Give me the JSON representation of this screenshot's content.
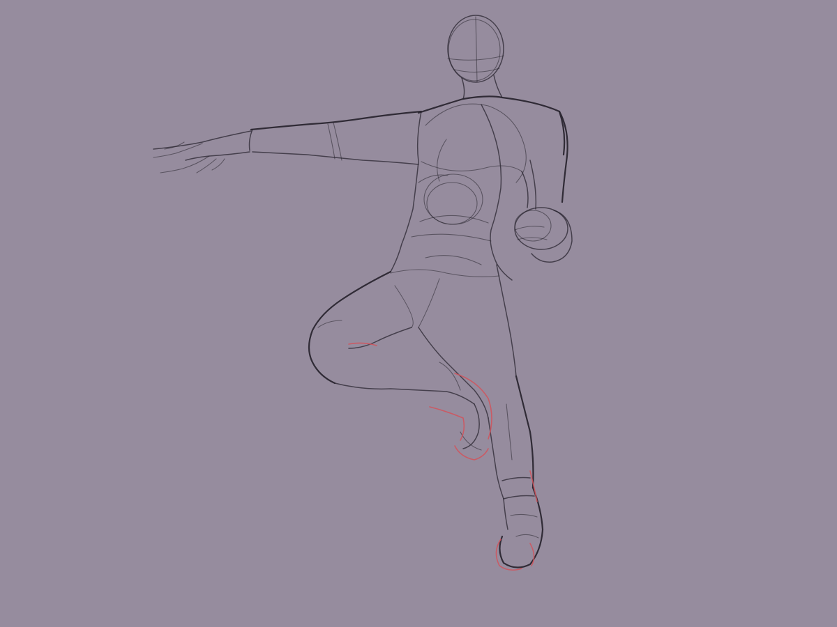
{
  "canvas": {
    "background": "#968c9e",
    "ink_color": "#2a2630",
    "correction_color": "#d2525a"
  },
  "subject": {
    "icon": "figure-sketch-icon"
  }
}
